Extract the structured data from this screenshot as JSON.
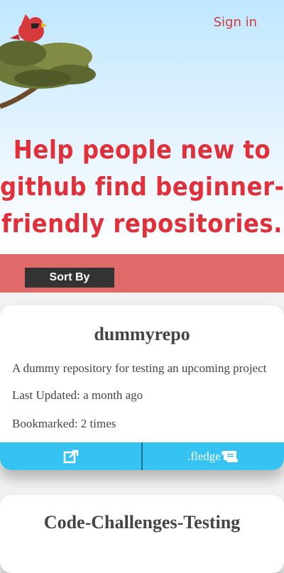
{
  "header": {
    "signin_label": "Sign in",
    "logo_icon": "cardinal-bird-on-tree-icon"
  },
  "hero": {
    "headline_lines": [
      "Help people new to",
      "github find beginner-",
      "friendly repositories."
    ]
  },
  "sort": {
    "label": "Sort By"
  },
  "repos": [
    {
      "name": "dummyrepo",
      "description": "A dummy repository for testing an upcoming project",
      "last_updated": "Last Updated: a month ago",
      "bookmarked": "Bookmarked: 2 times",
      "open_icon": "external-link-icon",
      "fledge_label": ".fledge",
      "fledge_icon": "scroll-icon"
    },
    {
      "name": "Code-Challenges-Testing"
    }
  ],
  "colors": {
    "accent_red": "#e0303a",
    "sort_bar": "#e06a6a",
    "action_bar": "#36c3f2"
  }
}
